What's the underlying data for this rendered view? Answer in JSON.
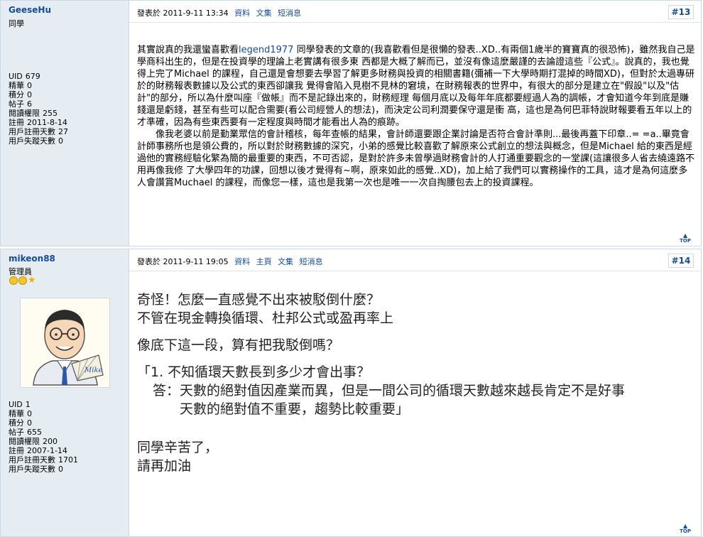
{
  "post13": {
    "username": "GeeseHu",
    "group": "同學",
    "stats": [
      {
        "label": "UID",
        "value": "679"
      },
      {
        "label": "精華",
        "value": "0"
      },
      {
        "label": "積分",
        "value": "0"
      },
      {
        "label": "帖子",
        "value": "6"
      },
      {
        "label": "閱讀權限",
        "value": "255"
      },
      {
        "label": "註冊",
        "value": "2011-8-14"
      },
      {
        "label": "用戶註冊天數",
        "value": "27"
      },
      {
        "label": "用戶失蹤天數",
        "value": "0"
      }
    ],
    "posted_label": "發表於",
    "posted_time": "2011-9-11 13:34",
    "links": [
      "資料",
      "文集",
      "短消息"
    ],
    "floor": "#13",
    "body_prefix": "其實說真的我還蠻喜歡看",
    "body_user": "legend1977",
    "body_p1_rest": " 同學發表的文章的(我喜歡看但是很懶的發表..XD..有兩個1歲半的寶寶真的很恐怖)，雖然我自己是學商科出生的，但是在投資學的理論上老實講有很多東 西都是大概了解而已，並沒有像這麼嚴謹的去論證這些『公式』。說真的，我也覺得上完了Michael 的課程，自己還是會想要去學習了解更多財務與投資的相關書籍(彌補一下大學時期打混掉的時間XD)，但對於太過專研於的財務報表數據以及公式的東西卻讓我 覺得會陷入見樹不見林的窘境，在財務報表的世界中，有很大的部分是建立在\"假設\"以及\"估計\"的部分，所以為什麼叫座『做帳』而不是記錄出來的，財務經理 每個月底以及每年年底都要經過人為的調帳，才會知道今年到底是賺錢還是虧錢，甚至有些可以配合需要(看公司經營人的想法)，而決定公司利潤要保守還是衝 高，這也是為何巴菲特說財報要看五年以上的才準確，因為有些東西要有一定程度與時間才能看出人為的痕跡。",
    "body_p2": "　　像我老婆以前是勤業眾信的會計稽核，每年查帳的結果，會計師還要跟企業討論是否符合會計準則...最後再蓋下印章..= =a..畢竟會計師事務所也是領公費的，所以對於財務數據的深究，小弟的感覺比較喜歡了解原來公式創立的想法與概念，但是Michael 給的東西是經過他的實務經驗化繁為簡的最重要的東西，不可否認，是對於許多未曾學過財務會計的人打通重要觀念的一堂課(這讓很多人省去繞遠路不用再像我修 了大學四年的功課，回想以後才覺得有~啊，原來如此的感覺..XD)，加上給了我們可以實務操作的工具，這才是為何這麼多人會讚賞Muchael 的課程，而像您一樣，這也是我第一次也是唯一一次自掏腰包去上的投資課程。",
    "top_label": "TOP"
  },
  "post14": {
    "username": "mikeon88",
    "group": "管理員",
    "avatar_caption": "Mike",
    "stats": [
      {
        "label": "UID",
        "value": "1"
      },
      {
        "label": "精華",
        "value": "0"
      },
      {
        "label": "積分",
        "value": "0"
      },
      {
        "label": "帖子",
        "value": "655"
      },
      {
        "label": "閱讀權限",
        "value": "200"
      },
      {
        "label": "註冊",
        "value": "2007-1-14"
      },
      {
        "label": "用戶註冊天數",
        "value": "1701"
      },
      {
        "label": "用戶失蹤天數",
        "value": "0"
      }
    ],
    "posted_label": "發表於",
    "posted_time": "2011-9-11 19:05",
    "links": [
      "資料",
      "主頁",
      "文集",
      "短消息"
    ],
    "floor": "#14",
    "line1": "奇怪！怎麼一直感覺不出來被駁倒什麼？",
    "line2": "不管在現金轉換循環、杜邦公式或盈再率上",
    "line3": "像底下這一段，算有把我駁倒嗎？",
    "quote_q": "「1. 不知循環天數長到多少才會出事？",
    "quote_a1": "答：天數的絕對值因產業而異，但是一間公司的循環天數越來越長肯定不是好事",
    "quote_a2": "天數的絕對值不重要，趨勢比較重要」",
    "line4": "同學辛苦了，",
    "line5": "請再加油",
    "top_label": "TOP"
  }
}
